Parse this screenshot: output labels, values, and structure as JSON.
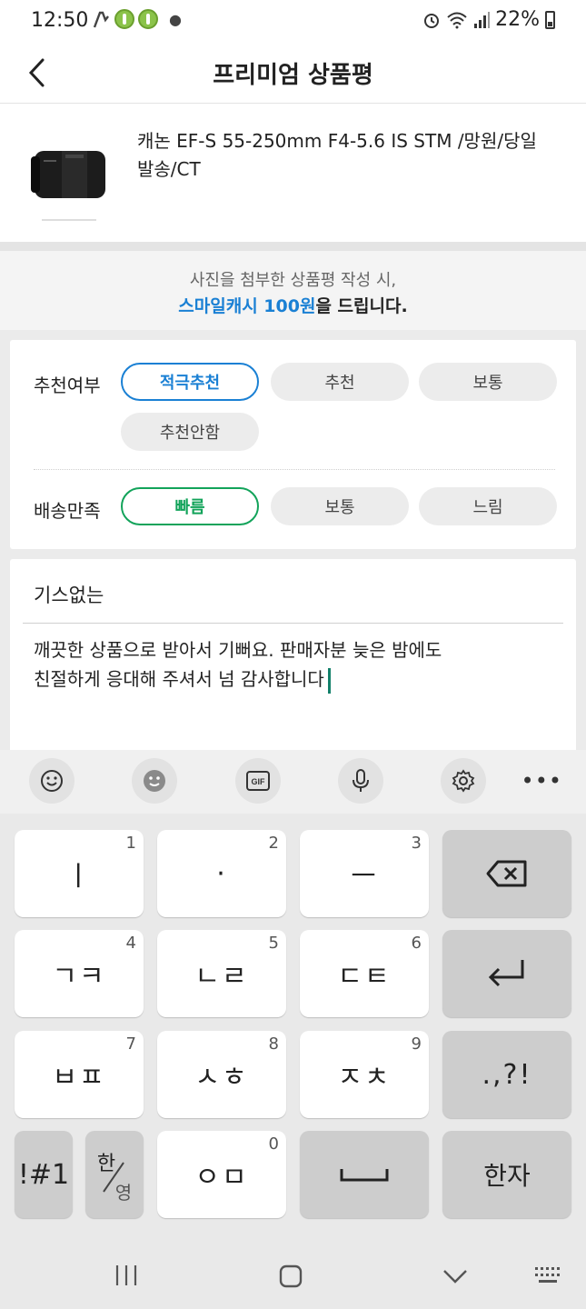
{
  "status_bar": {
    "time": "12:50",
    "battery": "22%"
  },
  "header": {
    "title": "프리미엄 상품평"
  },
  "product": {
    "name": "캐논 EF-S 55-250mm F4-5.6 IS STM /망원/당일발송/CT"
  },
  "banner": {
    "line1": "사진을 첨부한 상품평 작성 시,",
    "highlight": "스마일캐시 100원",
    "suffix": "을 드립니다."
  },
  "rating": {
    "recommend": {
      "label": "추천여부",
      "options": [
        "적극추천",
        "추천",
        "보통",
        "추천안함"
      ],
      "selected": "적극추천"
    },
    "shipping": {
      "label": "배송만족",
      "options": [
        "빠름",
        "보통",
        "느림"
      ],
      "selected": "빠름"
    },
    "colors": {
      "recommend_selected": "#1a80d4",
      "shipping_selected": "#12a35a"
    }
  },
  "review": {
    "title": "기스없는",
    "body_line1": "깨끗한 상품으로 받아서 기뻐요. 판매자분 늦은 밤에도",
    "body_line2": "친절하게  응대해 주셔서 넘 감사합니다"
  },
  "keyboard_toolbar": {
    "buttons": [
      "emoji-icon",
      "sticker-icon",
      "gif-icon",
      "mic-icon",
      "settings-icon",
      "more-icon"
    ],
    "gif_label": "GIF",
    "more_label": "•••"
  },
  "keyboard": {
    "row1": [
      {
        "num": "1",
        "label": "ㅣ"
      },
      {
        "num": "2",
        "label": "·"
      },
      {
        "num": "3",
        "label": "ㅡ"
      }
    ],
    "row2": [
      {
        "num": "4",
        "label": "ㄱㅋ"
      },
      {
        "num": "5",
        "label": "ㄴㄹ"
      },
      {
        "num": "6",
        "label": "ㄷㅌ"
      }
    ],
    "row3": [
      {
        "num": "7",
        "label": "ㅂㅍ"
      },
      {
        "num": "8",
        "label": "ㅅㅎ"
      },
      {
        "num": "9",
        "label": "ㅈㅊ"
      }
    ],
    "punct": ".,?!",
    "symbols": "!#1",
    "lang_top": "한",
    "lang_bottom": "영",
    "row4_mid": {
      "num": "0",
      "label": "ㅇㅁ"
    },
    "hanja": "한자"
  }
}
